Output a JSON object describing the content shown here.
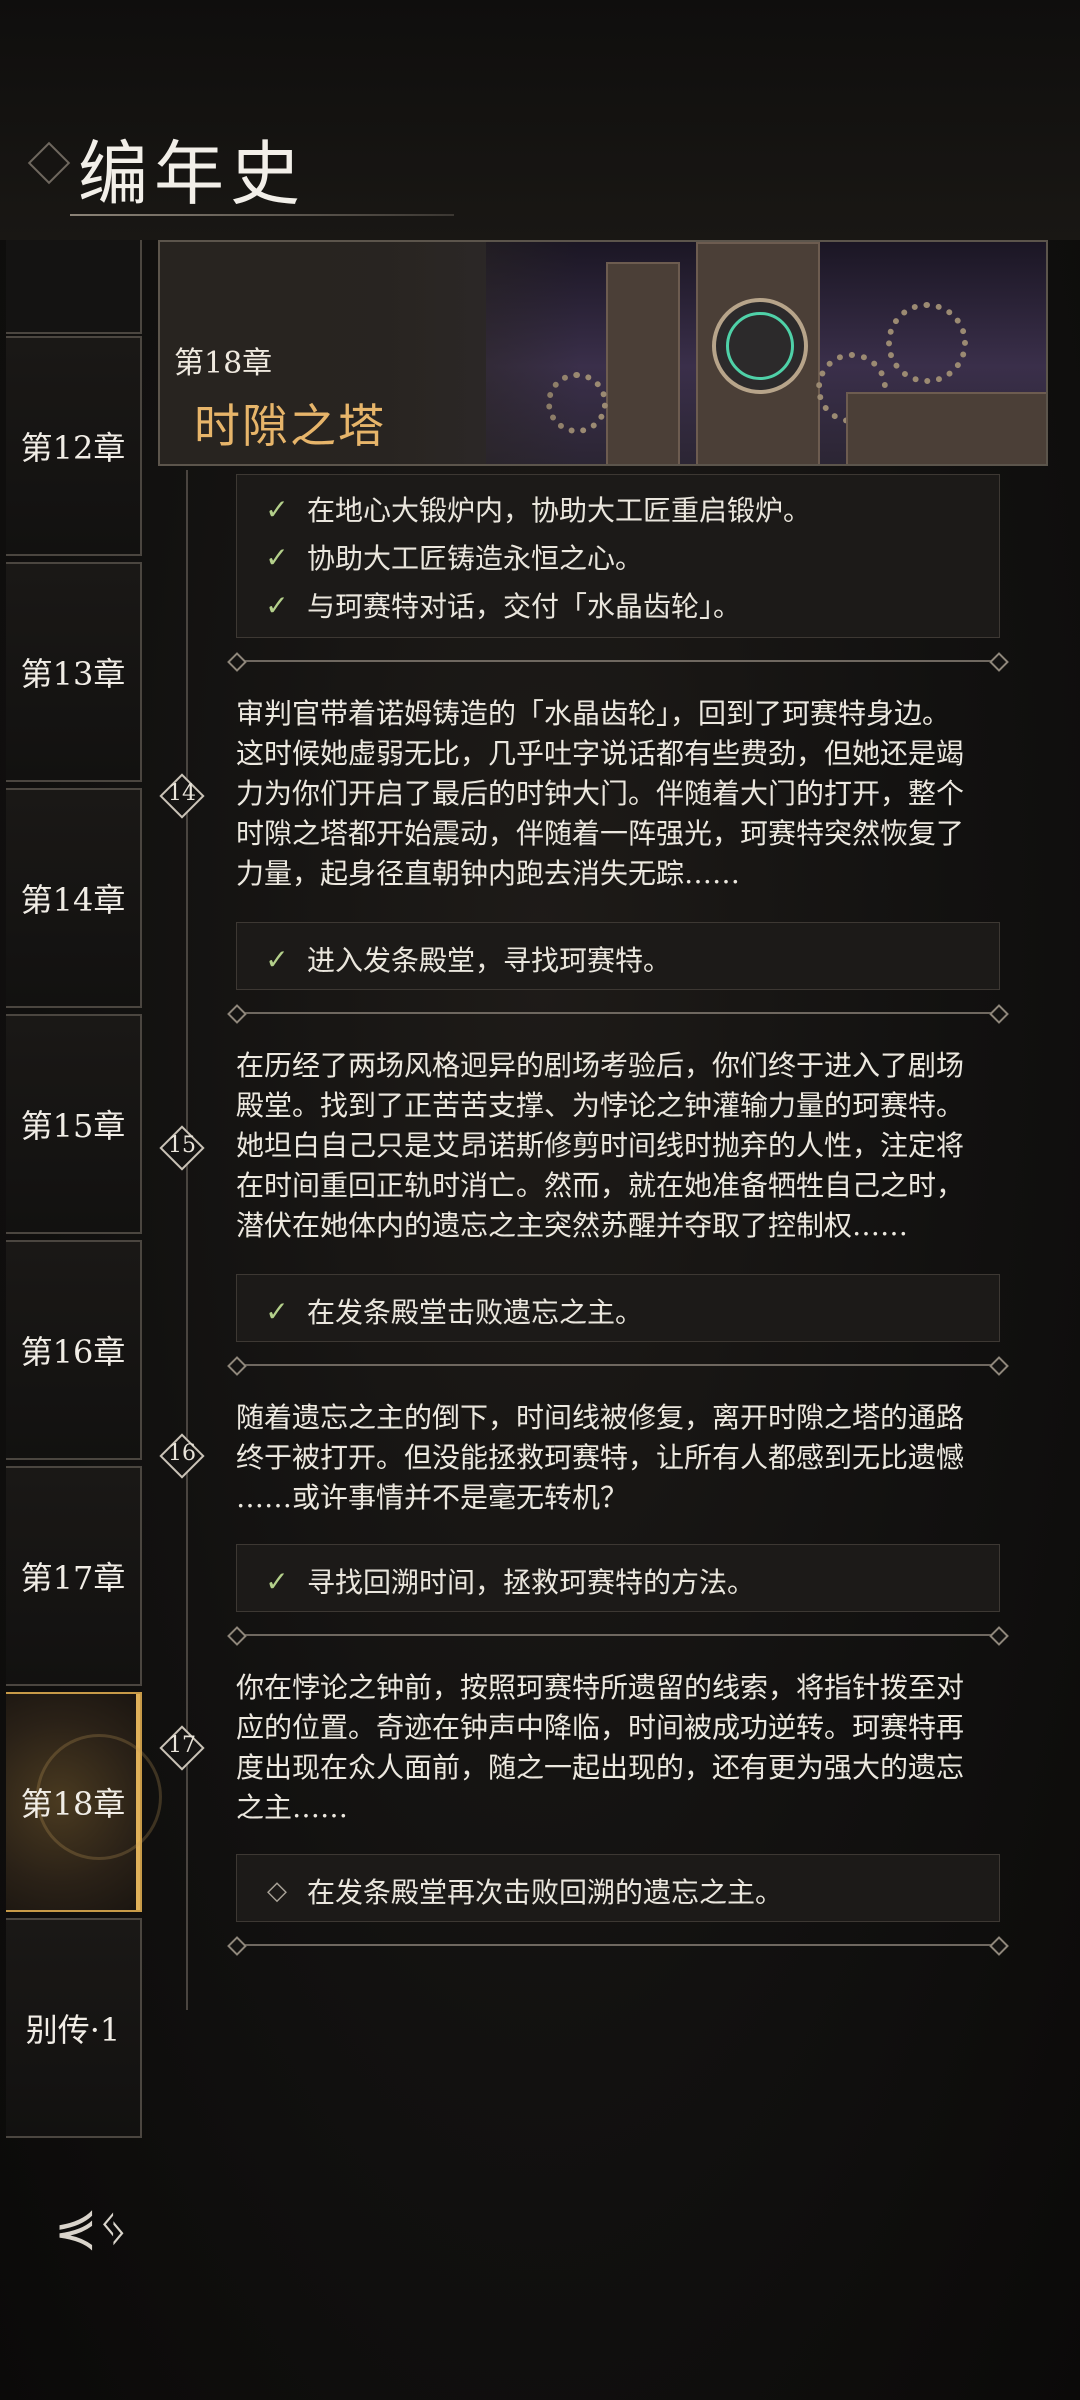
{
  "page": {
    "title": "编年史"
  },
  "sidebar": {
    "tabs": [
      {
        "label": "第12章"
      },
      {
        "label": "第13章"
      },
      {
        "label": "第14章"
      },
      {
        "label": "第15章"
      },
      {
        "label": "第16章"
      },
      {
        "label": "第17章"
      },
      {
        "label": "第18章",
        "active": true
      },
      {
        "label": "别传·1"
      }
    ]
  },
  "banner": {
    "chapter_number": "第18章",
    "chapter_title": "时隙之塔"
  },
  "objectives_top": [
    {
      "text": "在地心大锻炉内，协助大工匠重启锻炉。",
      "done": true
    },
    {
      "text": "协助大工匠铸造永恒之心。",
      "done": true
    },
    {
      "text": "与珂赛特对话，交付「水晶齿轮」。",
      "done": true
    }
  ],
  "sections": [
    {
      "node": "14",
      "text": "审判官带着诺姆铸造的「水晶齿轮」，回到了珂赛特身边。\n这时候她虚弱无比，几乎吐字说话都有些费劲，但她还是竭\n力为你们开启了最后的时钟大门。伴随着大门的打开，整个\n时隙之塔都开始震动，伴随着一阵强光，珂赛特突然恢复了\n力量，起身径直朝钟内跑去消失无踪……",
      "objectives": [
        {
          "text": "进入发条殿堂，寻找珂赛特。",
          "done": true
        }
      ]
    },
    {
      "node": "15",
      "text": "在历经了两场风格迥异的剧场考验后，你们终于进入了剧场\n殿堂。找到了正苦苦支撑、为悖论之钟灌输力量的珂赛特。\n她坦白自己只是艾昂诺斯修剪时间线时抛弃的人性，注定将\n在时间重回正轨时消亡。然而，就在她准备牺牲自己之时，\n潜伏在她体内的遗忘之主突然苏醒并夺取了控制权……",
      "objectives": [
        {
          "text": "在发条殿堂击败遗忘之主。",
          "done": true
        }
      ]
    },
    {
      "node": "16",
      "text": "随着遗忘之主的倒下，时间线被修复，离开时隙之塔的通路\n终于被打开。但没能拯救珂赛特，让所有人都感到无比遗憾\n……或许事情并不是毫无转机？",
      "objectives": [
        {
          "text": "寻找回溯时间，拯救珂赛特的方法。",
          "done": true
        }
      ]
    },
    {
      "node": "17",
      "text": "你在悖论之钟前，按照珂赛特所遗留的线索，将指针拨至对\n应的位置。奇迹在钟声中降临，时间被成功逆转。珂赛特再\n度出现在众人面前，随之一起出现的，还有更为强大的遗忘\n之主……",
      "objectives": [
        {
          "text": "在发条殿堂再次击败回溯的遗忘之主。",
          "done": false
        }
      ]
    }
  ],
  "icons": {
    "check": "check-icon",
    "pending": "diamond-outline-icon",
    "logo": "game-logo-icon"
  }
}
